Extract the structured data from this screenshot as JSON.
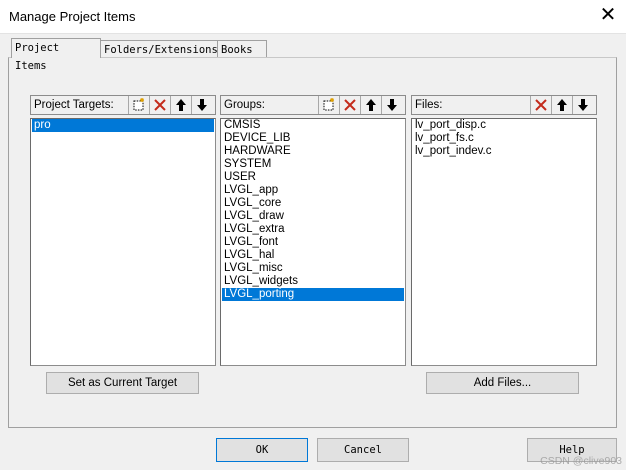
{
  "window": {
    "title": "Manage Project Items",
    "close_glyph": "✕"
  },
  "tabs": [
    {
      "label": "Project Items",
      "active": true
    },
    {
      "label": "Folders/Extensions",
      "active": false
    },
    {
      "label": "Books",
      "active": false
    }
  ],
  "targets": {
    "header_label": "Project Targets:",
    "toolbar": [
      "new-icon",
      "delete-icon",
      "move-up-icon",
      "move-down-icon"
    ],
    "items": [
      "pro"
    ],
    "selected_index": 0,
    "action_label": "Set as Current Target"
  },
  "groups": {
    "header_label": "Groups:",
    "toolbar": [
      "new-icon",
      "delete-icon",
      "move-up-icon",
      "move-down-icon"
    ],
    "items": [
      "CMSIS",
      "DEVICE_LIB",
      "HARDWARE",
      "SYSTEM",
      "USER",
      "LVGL_app",
      "LVGL_core",
      "LVGL_draw",
      "LVGL_extra",
      "LVGL_font",
      "LVGL_hal",
      "LVGL_misc",
      "LVGL_widgets",
      "LVGL_porting"
    ],
    "selected_index": 13
  },
  "files": {
    "header_label": "Files:",
    "toolbar": [
      "delete-icon",
      "move-up-icon",
      "move-down-icon"
    ],
    "items": [
      "lv_port_disp.c",
      "lv_port_fs.c",
      "lv_port_indev.c"
    ],
    "action_label": "Add Files..."
  },
  "footer": {
    "ok_label": "OK",
    "cancel_label": "Cancel",
    "help_label": "Help",
    "watermark": "CSDN @clive903"
  },
  "colors": {
    "selection": "#0078d7",
    "delete_red": "#c42b1c"
  }
}
